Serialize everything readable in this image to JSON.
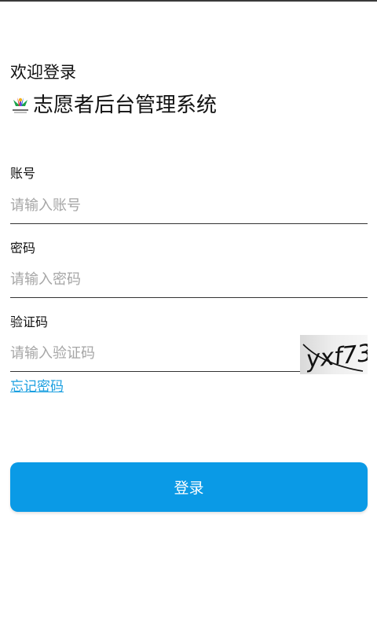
{
  "header": {
    "welcome": "欢迎登录",
    "app_title": "志愿者后台管理系统",
    "logo_icon": "volunteer-logo-icon"
  },
  "form": {
    "account": {
      "label": "账号",
      "placeholder": "请输入账号",
      "value": ""
    },
    "password": {
      "label": "密码",
      "placeholder": "请输入密码",
      "value": ""
    },
    "captcha": {
      "label": "验证码",
      "placeholder": "请输入验证码",
      "value": "",
      "image_text": "yxf73"
    },
    "forgot_password": "忘记密码",
    "login_button": "登录"
  },
  "colors": {
    "accent": "#0a9ae6",
    "link": "#1a9fe0",
    "placeholder": "#a6a6a6",
    "text": "#111111"
  }
}
